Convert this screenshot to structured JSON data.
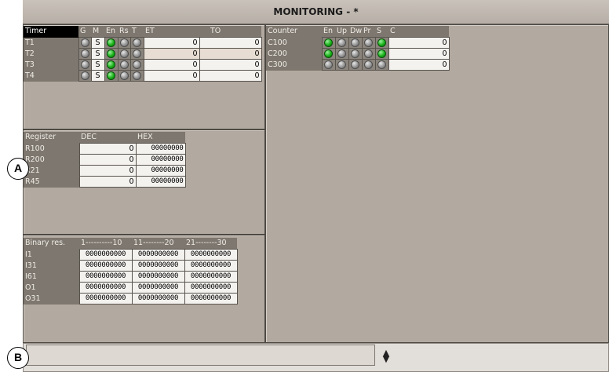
{
  "window": {
    "title": "MONITORING - *"
  },
  "timer": {
    "headers": [
      "Timer",
      "G",
      "M",
      "En",
      "Rs",
      "T",
      "ET",
      "TO"
    ],
    "rows": [
      {
        "name": "T1",
        "g": false,
        "m": "S",
        "en": true,
        "rs": false,
        "t": false,
        "et": "0",
        "to": "0",
        "highlight": false
      },
      {
        "name": "T2",
        "g": false,
        "m": "S",
        "en": true,
        "rs": false,
        "t": false,
        "et": "0",
        "to": "0",
        "highlight": true
      },
      {
        "name": "T3",
        "g": false,
        "m": "S",
        "en": true,
        "rs": false,
        "t": false,
        "et": "0",
        "to": "0",
        "highlight": false
      },
      {
        "name": "T4",
        "g": false,
        "m": "S",
        "en": true,
        "rs": false,
        "t": false,
        "et": "0",
        "to": "0",
        "highlight": false
      }
    ]
  },
  "register": {
    "headers": [
      "Register",
      "DEC",
      "HEX"
    ],
    "rows": [
      {
        "name": "R100",
        "dec": "0",
        "hex": "00000000"
      },
      {
        "name": "R200",
        "dec": "0",
        "hex": "00000000"
      },
      {
        "name": "R21",
        "dec": "0",
        "hex": "00000000"
      },
      {
        "name": "R45",
        "dec": "0",
        "hex": "00000000"
      }
    ]
  },
  "binary": {
    "headers": [
      "Binary res.",
      "1----------10",
      "11--------20",
      "21--------30"
    ],
    "rows": [
      {
        "name": "I1",
        "b1": "0000000000",
        "b2": "0000000000",
        "b3": "0000000000"
      },
      {
        "name": "I31",
        "b1": "0000000000",
        "b2": "0000000000",
        "b3": "0000000000"
      },
      {
        "name": "I61",
        "b1": "0000000000",
        "b2": "0000000000",
        "b3": "0000000000"
      },
      {
        "name": "O1",
        "b1": "0000000000",
        "b2": "0000000000",
        "b3": "0000000000"
      },
      {
        "name": "O31",
        "b1": "0000000000",
        "b2": "0000000000",
        "b3": "0000000000"
      }
    ]
  },
  "counter": {
    "headers": [
      "Counter",
      "En",
      "Up",
      "Dw",
      "Pr",
      "S",
      "C"
    ],
    "rows": [
      {
        "name": "C100",
        "en": true,
        "up": false,
        "dw": false,
        "pr": false,
        "s": true,
        "c": "0"
      },
      {
        "name": "C200",
        "en": true,
        "up": false,
        "dw": false,
        "pr": false,
        "s": true,
        "c": "0"
      },
      {
        "name": "C300",
        "en": false,
        "up": false,
        "dw": false,
        "pr": false,
        "s": false,
        "c": "0"
      }
    ]
  },
  "callouts": {
    "a": "A",
    "b": "B"
  },
  "colors": {
    "window_bg": "#b2aaa0",
    "header_bg": "#7d776f",
    "led_on": "#19b119",
    "led_off": "#8e8e8e"
  }
}
